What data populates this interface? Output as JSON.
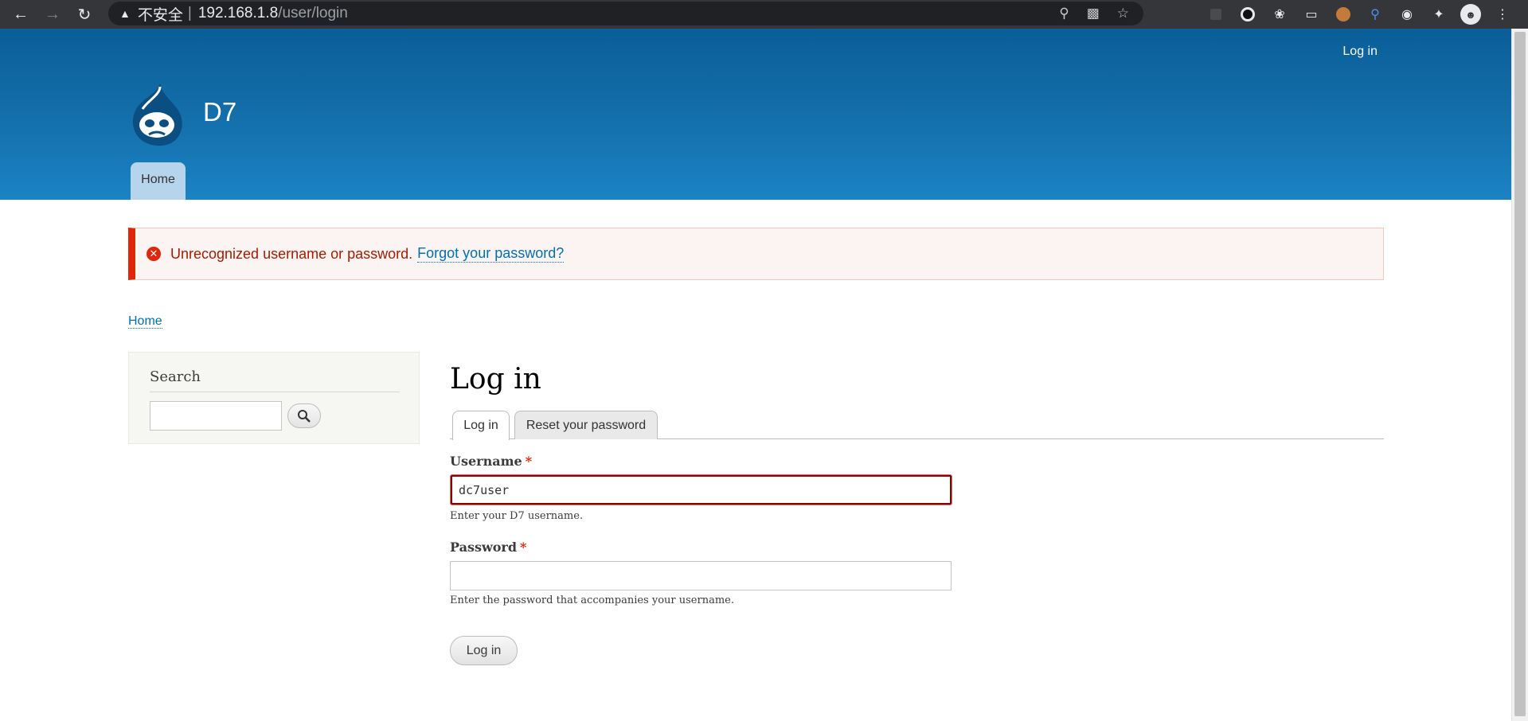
{
  "browser": {
    "security_label": "不安全",
    "url_host": "192.168.1.8",
    "url_path": "/user/login"
  },
  "header": {
    "site_name": "D7",
    "secondary_menu_login": "Log in",
    "main_menu_home": "Home"
  },
  "message": {
    "error_text": "Unrecognized username or password.",
    "link_text": "Forgot your password?",
    "error_color": "#e0260b"
  },
  "breadcrumb": {
    "home": "Home"
  },
  "sidebar": {
    "search_title": "Search",
    "search_value": ""
  },
  "main": {
    "title": "Log in",
    "tabs": [
      {
        "label": "Log in",
        "active": true
      },
      {
        "label": "Reset your password",
        "active": false
      }
    ],
    "username": {
      "label": "Username",
      "required_mark": "*",
      "value": "dc7user",
      "description": "Enter your D7 username."
    },
    "password": {
      "label": "Password",
      "required_mark": "*",
      "value": "",
      "description": "Enter the password that accompanies your username."
    },
    "submit_label": "Log in"
  },
  "colors": {
    "header_top": "#0a5e99",
    "header_bottom": "#1b83c5",
    "link": "#0071b3"
  }
}
